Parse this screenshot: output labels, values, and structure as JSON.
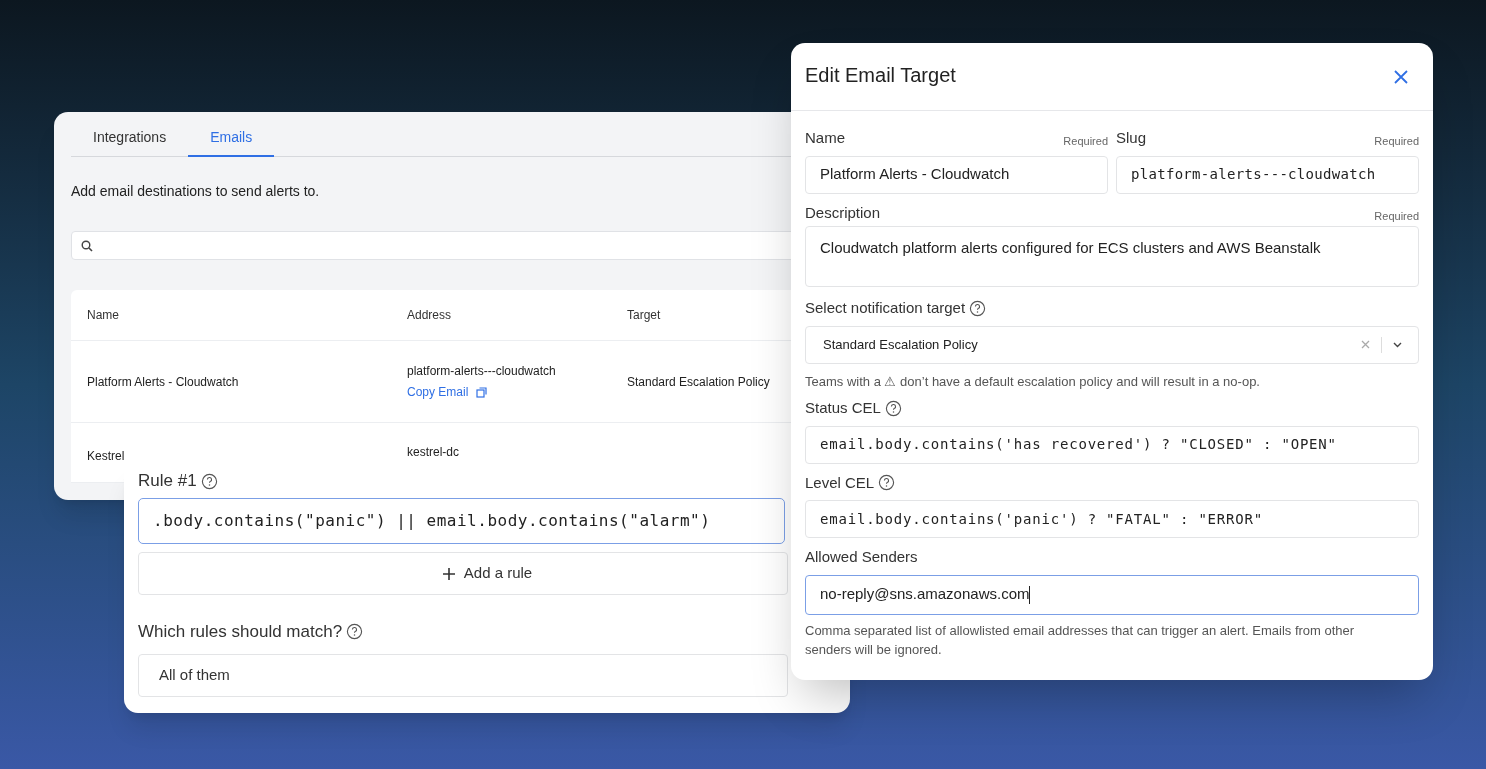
{
  "integrations_panel": {
    "tabs": [
      {
        "label": "Integrations",
        "selected": false
      },
      {
        "label": "Emails",
        "selected": true
      }
    ],
    "intro": "Add email destinations to send alerts to.",
    "table": {
      "columns": [
        "Name",
        "Address",
        "Target"
      ],
      "rows": [
        {
          "name": "Platform Alerts - Cloudwatch",
          "address": "platform-alerts---cloudwatch",
          "copy_link": "Copy Email",
          "target": "Standard Escalation Policy"
        },
        {
          "name": "Kestrel",
          "address": "kestrel-dc"
        }
      ]
    }
  },
  "rule_panel": {
    "rule_label": "Rule #1",
    "rule_value": ".body.contains(\"panic\") || email.body.contains(\"alarm\")",
    "rule_focused": true,
    "add_button": "Add a rule",
    "match_label": "Which rules should match?",
    "match_value": "All of them"
  },
  "dialog": {
    "title": "Edit Email Target",
    "name": {
      "label": "Name",
      "required": "Required",
      "value": "Platform Alerts - Cloudwatch"
    },
    "slug": {
      "label": "Slug",
      "required": "Required",
      "value": "platform-alerts---cloudwatch"
    },
    "description": {
      "label": "Description",
      "required": "Required",
      "value": "Cloudwatch platform alerts configured for ECS clusters and AWS Beanstalk"
    },
    "target": {
      "label": "Select notification target",
      "value": "Standard Escalation Policy",
      "hint": "Teams with a ⚠ don’t have a default escalation policy and will result in a no-op."
    },
    "status_cel": {
      "label": "Status CEL",
      "value": "email.body.contains('has recovered') ? \"CLOSED\" : \"OPEN\""
    },
    "level_cel": {
      "label": "Level CEL",
      "value": "email.body.contains('panic') ? \"FATAL\" : \"ERROR\""
    },
    "allowed_senders": {
      "label": "Allowed Senders",
      "value": "no-reply@sns.amazonaws.com",
      "focused": true,
      "help": "Comma separated list of allowlisted email addresses that can trigger an alert. Emails from other senders will be ignored."
    }
  }
}
